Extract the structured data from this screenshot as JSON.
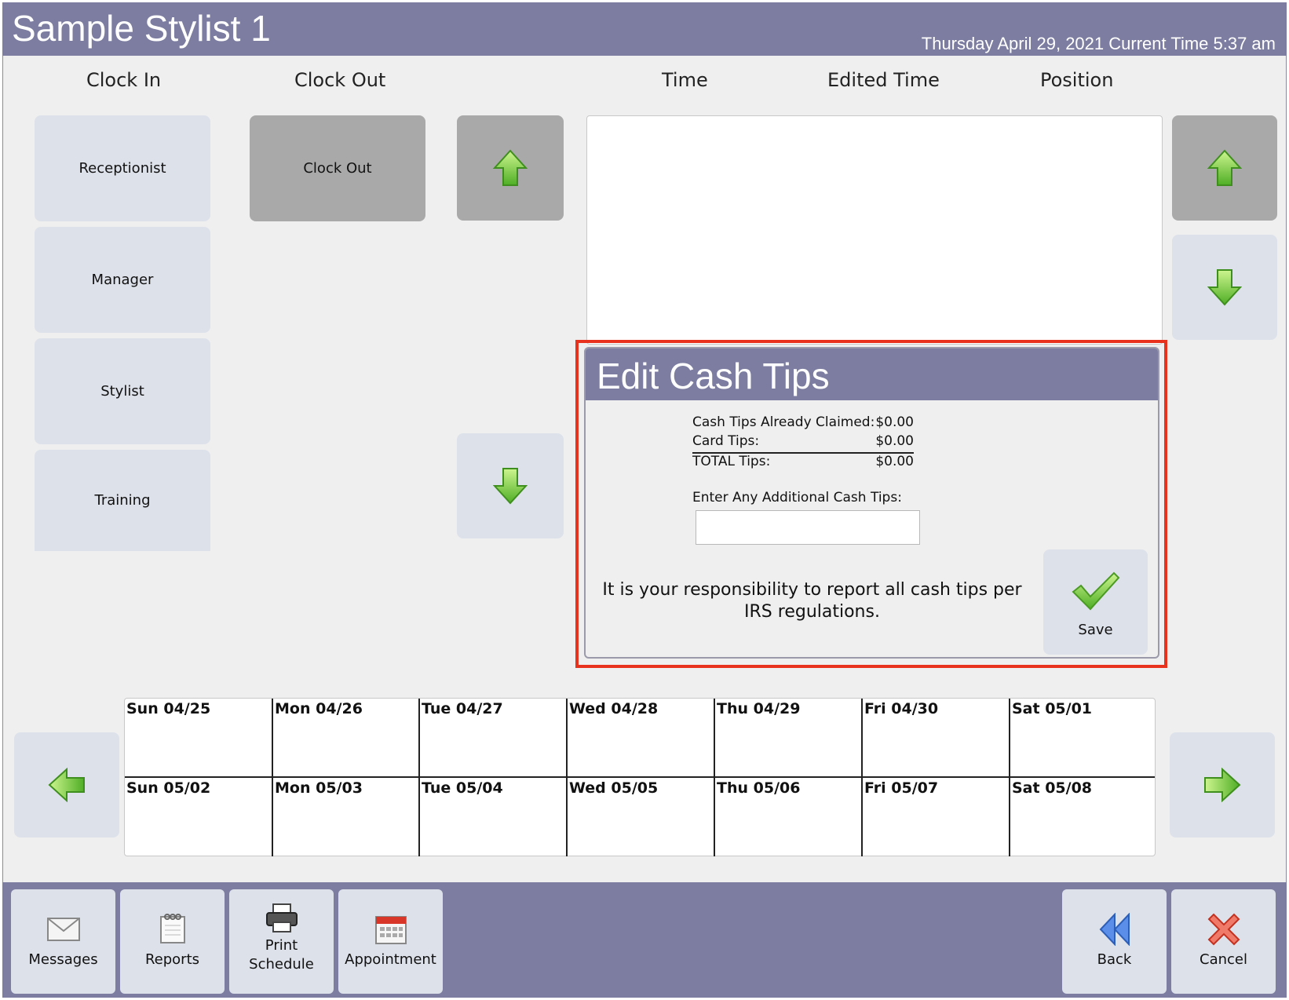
{
  "header": {
    "title": "Sample Stylist 1",
    "datetime": "Thursday April 29, 2021 Current Time 5:37 am"
  },
  "columns": {
    "clock_in": "Clock In",
    "clock_out": "Clock Out",
    "time": "Time",
    "edited_time": "Edited Time",
    "position": "Position"
  },
  "positions": [
    {
      "label": "Receptionist"
    },
    {
      "label": "Manager"
    },
    {
      "label": "Stylist"
    },
    {
      "label": "Training"
    }
  ],
  "clock_out_button": "Clock Out",
  "dialog": {
    "title": "Edit Cash Tips",
    "rows": [
      {
        "label": "Cash Tips Already Claimed:",
        "value": "$0.00"
      },
      {
        "label": "Card Tips:",
        "value": "$0.00"
      },
      {
        "label": "TOTAL Tips:",
        "value": "$0.00"
      }
    ],
    "additional_label": "Enter Any Additional Cash Tips:",
    "additional_value": "",
    "notice": "It is your responsibility to report all cash tips per IRS regulations.",
    "save_label": "Save"
  },
  "calendar": {
    "week1": [
      "Sun 04/25",
      "Mon 04/26",
      "Tue 04/27",
      "Wed 04/28",
      "Thu 04/29",
      "Fri 04/30",
      "Sat 05/01"
    ],
    "week2": [
      "Sun 05/02",
      "Mon 05/03",
      "Tue 05/04",
      "Wed 05/05",
      "Thu 05/06",
      "Fri 05/07",
      "Sat 05/08"
    ]
  },
  "toolbar": {
    "messages": "Messages",
    "reports": "Reports",
    "print_schedule_1": "Print",
    "print_schedule_2": "Schedule",
    "appointment": "Appointment",
    "back": "Back",
    "cancel": "Cancel"
  },
  "icons": {
    "up_arrow": "up-arrow-icon",
    "down_arrow": "down-arrow-icon",
    "left_arrow": "left-arrow-icon",
    "right_arrow": "right-arrow-icon",
    "save": "checkmark-icon",
    "messages": "envelope-icon",
    "reports": "notepad-icon",
    "print": "printer-icon",
    "appointment": "calendar-icon",
    "back": "rewind-icon",
    "cancel": "red-x-icon"
  },
  "colors": {
    "titlebar": "#7c7da0",
    "button": "#dde1ea",
    "button_disabled": "#a9a9a9",
    "highlight": "#e8321e",
    "arrow_green": "#6cc13a"
  }
}
